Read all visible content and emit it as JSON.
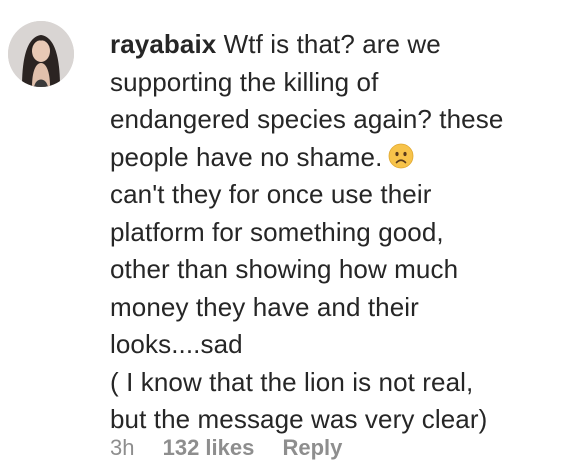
{
  "comment": {
    "username": "rayabaix",
    "lines": [
      "Wtf is that? are we",
      "supporting the killing of",
      "endangered species again? these",
      "people have no shame.",
      "can't they for once use their",
      "platform for something good,",
      "other than showing how much",
      "money they have and their",
      "looks....sad",
      "( I know that the lion is not real,",
      "but the message was very clear)"
    ],
    "emoji": "worried-face-icon",
    "time": "3h",
    "likes": "132 likes",
    "reply_label": "Reply"
  },
  "colors": {
    "text": "#262626",
    "meta": "#8e8e8e",
    "emoji_face": "#f7c34a"
  }
}
